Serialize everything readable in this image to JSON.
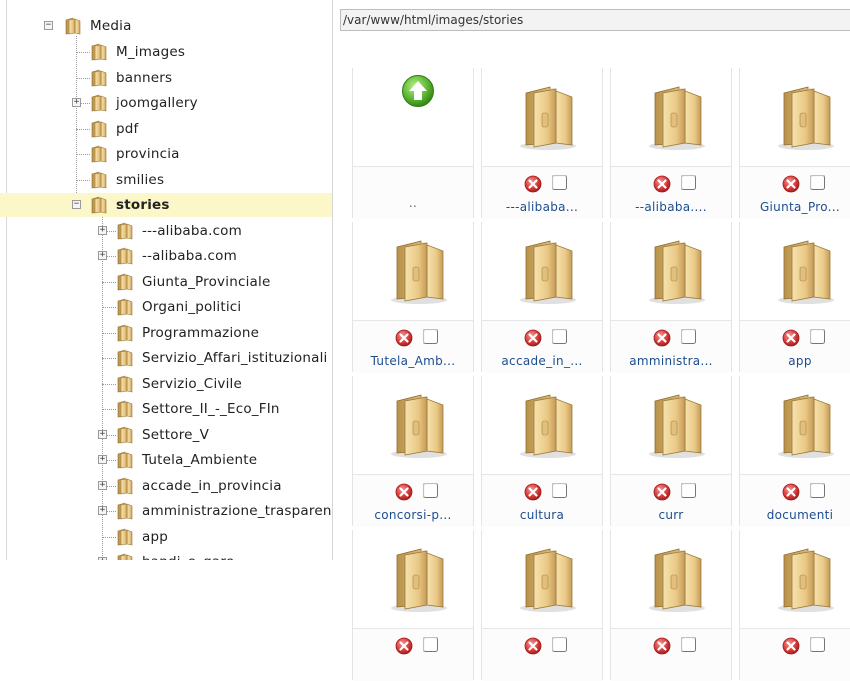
{
  "tree": {
    "root": "Media",
    "items": [
      {
        "label": "M_images",
        "expandable": false
      },
      {
        "label": "banners",
        "expandable": false
      },
      {
        "label": "joomgallery",
        "expandable": true
      },
      {
        "label": "pdf",
        "expandable": false
      },
      {
        "label": "provincia",
        "expandable": false
      },
      {
        "label": "smilies",
        "expandable": false
      },
      {
        "label": "stories",
        "expandable": true,
        "expanded": true,
        "selected": true
      }
    ],
    "subitems": [
      {
        "label": "---alibaba.com",
        "expandable": true
      },
      {
        "label": "--alibaba.com",
        "expandable": true
      },
      {
        "label": "Giunta_Provinciale",
        "expandable": false
      },
      {
        "label": "Organi_politici",
        "expandable": false
      },
      {
        "label": "Programmazione",
        "expandable": false
      },
      {
        "label": "Servizio_Affari_istituzionali",
        "expandable": false
      },
      {
        "label": "Servizio_Civile",
        "expandable": false
      },
      {
        "label": "Settore_II_-_Eco_FIn",
        "expandable": false
      },
      {
        "label": "Settore_V",
        "expandable": true
      },
      {
        "label": "Tutela_Ambiente",
        "expandable": true
      },
      {
        "label": "accade_in_provincia",
        "expandable": true
      },
      {
        "label": "amministrazione_trasparente",
        "expandable": true
      },
      {
        "label": "app",
        "expandable": false
      },
      {
        "label": "bandi_e_gare",
        "expandable": true
      }
    ]
  },
  "path": "/var/www/html/images/stories",
  "grid": {
    "up_label": "..",
    "folders": [
      "---alibaba...",
      "--alibaba....",
      "Giunta_Pro...",
      "Tutela_Amb...",
      "accade_in_...",
      "amministra...",
      "app",
      "concorsi-p...",
      "cultura",
      "curr",
      "documenti",
      "",
      "",
      "",
      ""
    ]
  },
  "icons": {
    "folder": "folder-icon",
    "up": "up-arrow-icon",
    "delete": "delete-icon",
    "expand": "plus-icon",
    "collapse": "minus-icon"
  },
  "colors": {
    "selected_row": "#fbf7c9",
    "link": "#1e4d8f",
    "delete_red": "#d83a3a",
    "up_green": "#5cb531"
  }
}
